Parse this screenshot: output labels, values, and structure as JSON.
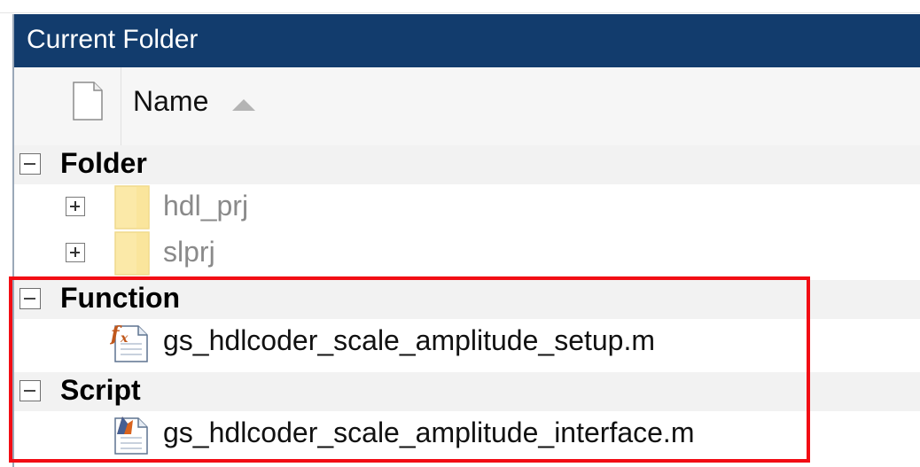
{
  "panel": {
    "title": "Current Folder"
  },
  "header": {
    "name_label": "Name"
  },
  "groups": {
    "folder": {
      "label": "Folder",
      "items": [
        {
          "name": "hdl_prj",
          "icon": "folder-icon"
        },
        {
          "name": "slprj",
          "icon": "folder-icon"
        }
      ]
    },
    "function": {
      "label": "Function",
      "items": [
        {
          "name": "gs_hdlcoder_scale_amplitude_setup.m",
          "icon": "function-file-icon"
        }
      ]
    },
    "script": {
      "label": "Script",
      "items": [
        {
          "name": "gs_hdlcoder_scale_amplitude_interface.m",
          "icon": "script-file-icon"
        }
      ]
    }
  },
  "colors": {
    "titlebar": "#123c6d",
    "highlight": "#f20d14",
    "folder": "#fbe9a8"
  }
}
